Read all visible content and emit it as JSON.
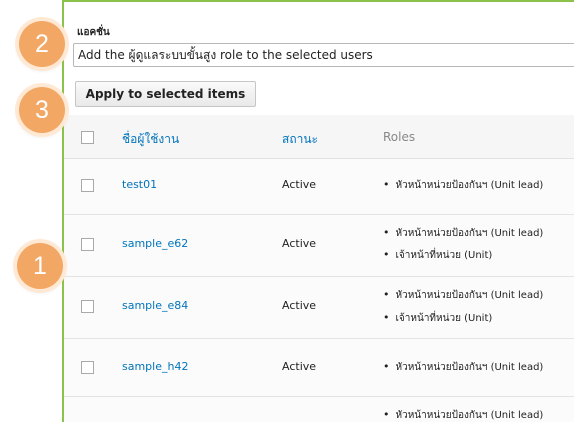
{
  "action": {
    "label": "แอคชั่น",
    "selected_option": "Add the ผู้ดูแลระบบขั้นสูง role to the selected users",
    "apply_button": "Apply to selected items"
  },
  "table": {
    "headers": {
      "username": "ชื่อผู้ใช้งาน",
      "status": "สถานะ",
      "roles": "Roles"
    },
    "rows": [
      {
        "username": "test01",
        "status": "Active",
        "roles": [
          "หัวหน้าหน่วยป้องกันฯ (Unit lead)"
        ]
      },
      {
        "username": "sample_e62",
        "status": "Active",
        "roles": [
          "หัวหน้าหน่วยป้องกันฯ (Unit lead)",
          "เจ้าหน้าที่หน่วย (Unit)"
        ]
      },
      {
        "username": "sample_e84",
        "status": "Active",
        "roles": [
          "หัวหน้าหน่วยป้องกันฯ (Unit lead)",
          "เจ้าหน้าที่หน่วย (Unit)"
        ]
      },
      {
        "username": "sample_h42",
        "status": "Active",
        "roles": [
          "หัวหน้าหน่วยป้องกันฯ (Unit lead)"
        ]
      },
      {
        "username": "",
        "status": "",
        "roles": [
          "หัวหน้าหน่วยป้องกันฯ (Unit lead)"
        ]
      }
    ]
  },
  "annotations": [
    "1",
    "2",
    "3"
  ],
  "colors": {
    "link": "#0074bd",
    "badge": "#f2a765",
    "frame": "#8bc34a"
  }
}
